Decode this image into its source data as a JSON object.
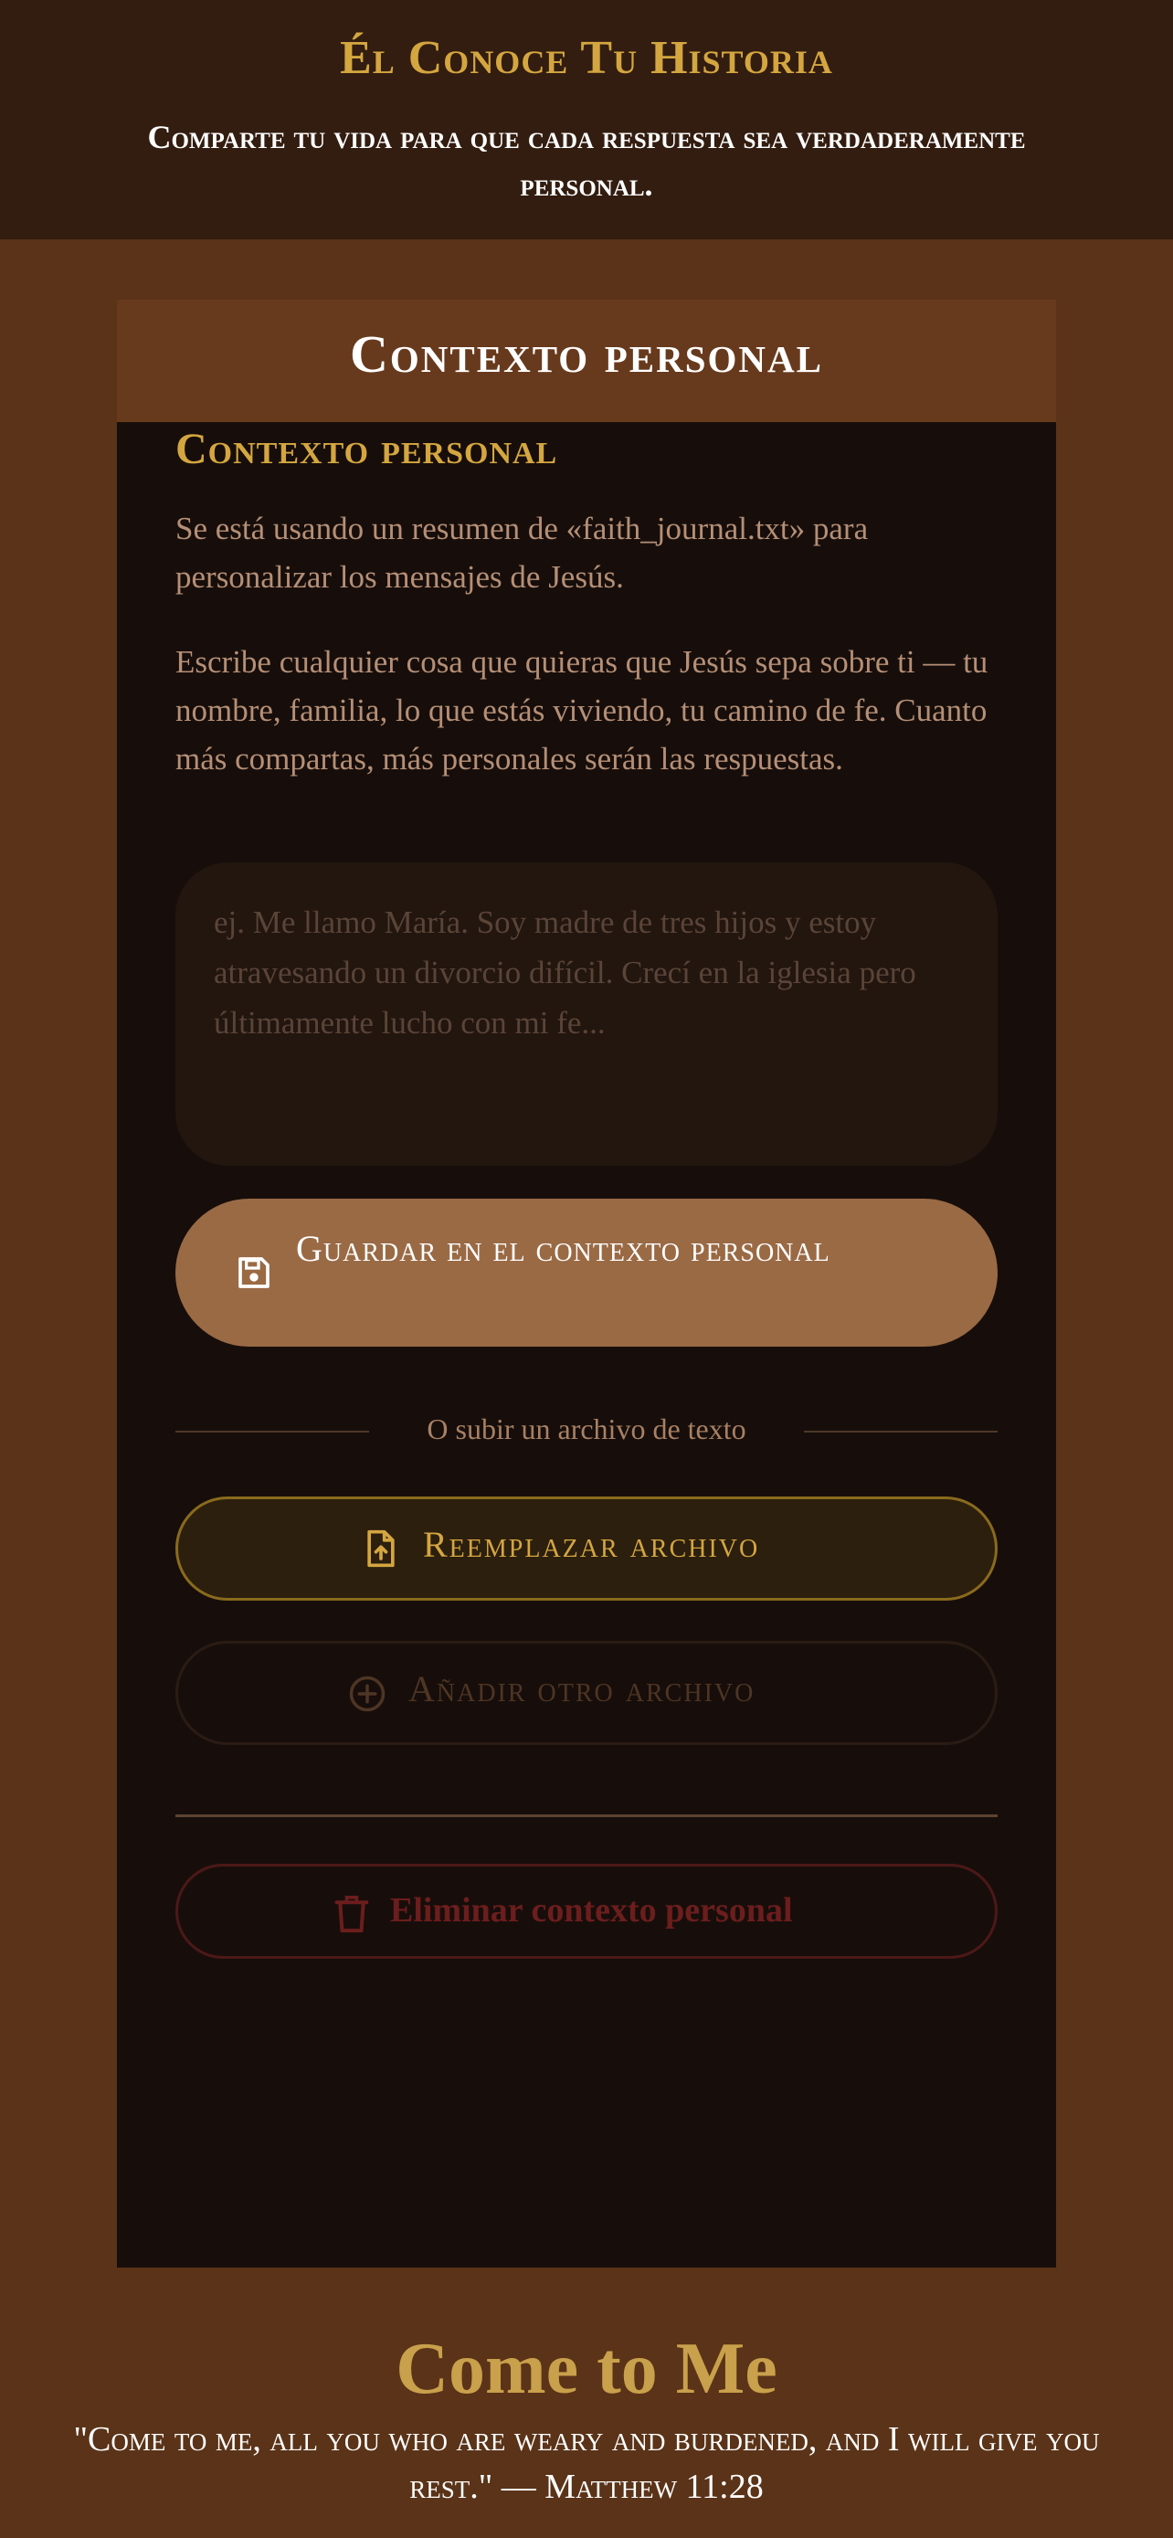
{
  "header": {
    "title": "Él Conoce Tu Historia",
    "subtitle": "Comparte tu vida para que cada respuesta sea verdaderamente personal."
  },
  "card": {
    "header_title": "Contexto personal",
    "section_title": "Contexto personal",
    "summary_text": "Se está usando un resumen de «faith_journal.txt» para personalizar los mensajes de Jesús.",
    "instructions_text": "Escribe cualquier cosa que quieras que Jesús sepa sobre ti — tu nombre, familia, lo que estás viviendo, tu camino de fe. Cuanto más compartas, más personales serán las respuestas.",
    "textarea": {
      "value": "",
      "placeholder": "ej. Me llamo María. Soy madre de tres hijos y estoy atravesando un divorcio difícil. Crecí en la iglesia pero últimamente lucho con mi fe..."
    },
    "save_button_label": "Guardar en el contexto personal",
    "save_icon": "floppy-disk-icon",
    "divider_text": "O subir un archivo de texto",
    "replace_button_label": "Reemplazar archivo",
    "replace_icon": "file-upload-icon",
    "add_button_label": "Añadir otro archivo",
    "add_icon": "plus-circle-icon",
    "delete_button_label": "Eliminar contexto personal",
    "delete_icon": "trash-icon"
  },
  "footer": {
    "title": "Come to Me",
    "verse": "\"Come to me, all you who are weary and burdened, and I will give you rest.\" — Matthew 11:28"
  },
  "colors": {
    "page_bg": "#5a3318",
    "header_bg": "#331d10",
    "card_bg": "#170e0b",
    "card_header_bg": "#683a1d",
    "gold": "#d4a640",
    "save_button_bg": "#9a6a45",
    "danger": "#6c1d1d"
  }
}
